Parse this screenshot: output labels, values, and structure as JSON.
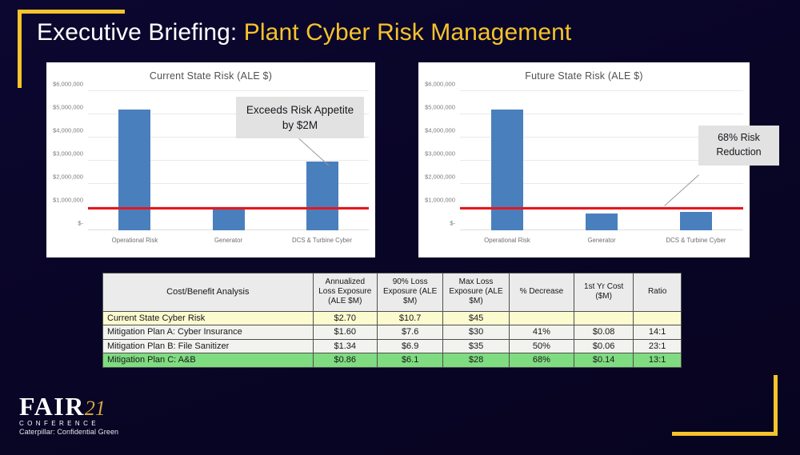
{
  "slide": {
    "title_main": "Executive Briefing: ",
    "title_accent": "Plant Cyber Risk Management",
    "accent_color": "#f5c32c",
    "background_color": "#090527"
  },
  "footer": {
    "logo_text": "FAIR",
    "logo_year": "21",
    "logo_sub": "CONFERENCE",
    "confidential": "Caterpillar: Confidential Green"
  },
  "callouts": {
    "exceeds": "Exceeds Risk Appetite by $2M",
    "reduction": "68% Risk Reduction"
  },
  "chart_data": [
    {
      "type": "bar",
      "title": "Current State Risk (ALE $)",
      "categories": [
        "Operational Risk",
        "Generator",
        "DCS & Turbine Cyber"
      ],
      "values": [
        5200000,
        880000,
        2950000
      ],
      "xlabel": "",
      "ylabel": "",
      "ylim": [
        0,
        6000000
      ],
      "ytick_labels": [
        "$6,000,000",
        "$5,000,000",
        "$4,000,000",
        "$3,000,000",
        "$2,000,000",
        "$1,000,000",
        "$-"
      ],
      "ytick_values": [
        6000000,
        5000000,
        4000000,
        3000000,
        2000000,
        1000000,
        0
      ],
      "threshold_line": {
        "value": 900000,
        "color": "#e8161c",
        "label": "Risk Appetite"
      },
      "bar_color": "#4a7fbd",
      "grid": true,
      "legend": "none",
      "annotation": "Exceeds Risk Appetite by $2M"
    },
    {
      "type": "bar",
      "title": "Future State Risk (ALE $)",
      "categories": [
        "Operational Risk",
        "Generator",
        "DCS & Turbine Cyber"
      ],
      "values": [
        5200000,
        740000,
        790000
      ],
      "xlabel": "",
      "ylabel": "",
      "ylim": [
        0,
        6000000
      ],
      "ytick_labels": [
        "$6,000,000",
        "$5,000,000",
        "$4,000,000",
        "$3,000,000",
        "$2,000,000",
        "$1,000,000",
        "$-"
      ],
      "ytick_values": [
        6000000,
        5000000,
        4000000,
        3000000,
        2000000,
        1000000,
        0
      ],
      "threshold_line": {
        "value": 900000,
        "color": "#e8161c",
        "label": "Risk Appetite"
      },
      "bar_color": "#4a7fbd",
      "grid": true,
      "legend": "none",
      "annotation": "68% Risk Reduction"
    }
  ],
  "table": {
    "headers": [
      "Cost/Benefit Analysis",
      "Annualized Loss Exposure (ALE $M)",
      "90% Loss Exposure (ALE $M)",
      "Max Loss Exposure (ALE $M)",
      "% Decrease",
      "1st Yr Cost ($M)",
      "Ratio"
    ],
    "rows": [
      {
        "label": "Current State Cyber Risk",
        "ale": "$2.70",
        "loss90": "$10.7",
        "maxloss": "$45",
        "decrease": "",
        "cost": "",
        "ratio": "",
        "highlight": "current"
      },
      {
        "label": "Mitigation Plan A: Cyber Insurance",
        "ale": "$1.60",
        "loss90": "$7.6",
        "maxloss": "$30",
        "decrease": "41%",
        "cost": "$0.08",
        "ratio": "14:1",
        "highlight": "plain"
      },
      {
        "label": "Mitigation Plan B: File Sanitizer",
        "ale": "$1.34",
        "loss90": "$6.9",
        "maxloss": "$35",
        "decrease": "50%",
        "cost": "$0.06",
        "ratio": "23:1",
        "highlight": "plain"
      },
      {
        "label": "Mitigation Plan C: A&B",
        "ale": "$0.86",
        "loss90": "$6.1",
        "maxloss": "$28",
        "decrease": "68%",
        "cost": "$0.14",
        "ratio": "13:1",
        "highlight": "best"
      }
    ]
  }
}
